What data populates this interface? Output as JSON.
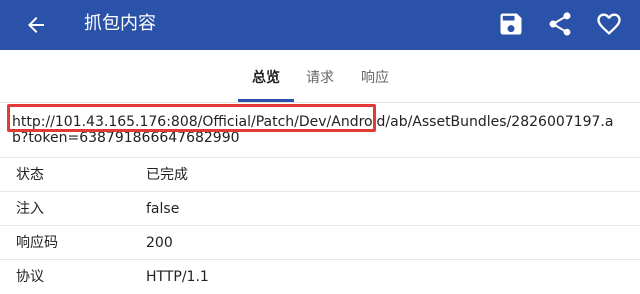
{
  "header": {
    "title": "抓包内容",
    "icons": {
      "back": "arrow-back-icon",
      "save": "save-icon",
      "share": "share-icon",
      "favorite": "heart-icon"
    },
    "background": "#2a52a8"
  },
  "tabs": [
    {
      "label": "总览",
      "active": true
    },
    {
      "label": "请求",
      "active": false
    },
    {
      "label": "响应",
      "active": false
    }
  ],
  "request": {
    "url": "http://101.43.165.176:808/Official/Patch/Dev/Android/ab/AssetBundles/2826007197.ab?token=638791866647682990"
  },
  "details": [
    {
      "key": "状态",
      "value": "已完成"
    },
    {
      "key": "注入",
      "value": "false"
    },
    {
      "key": "响应码",
      "value": "200"
    },
    {
      "key": "协议",
      "value": "HTTP/1.1"
    }
  ],
  "highlight_color": "#e53935"
}
